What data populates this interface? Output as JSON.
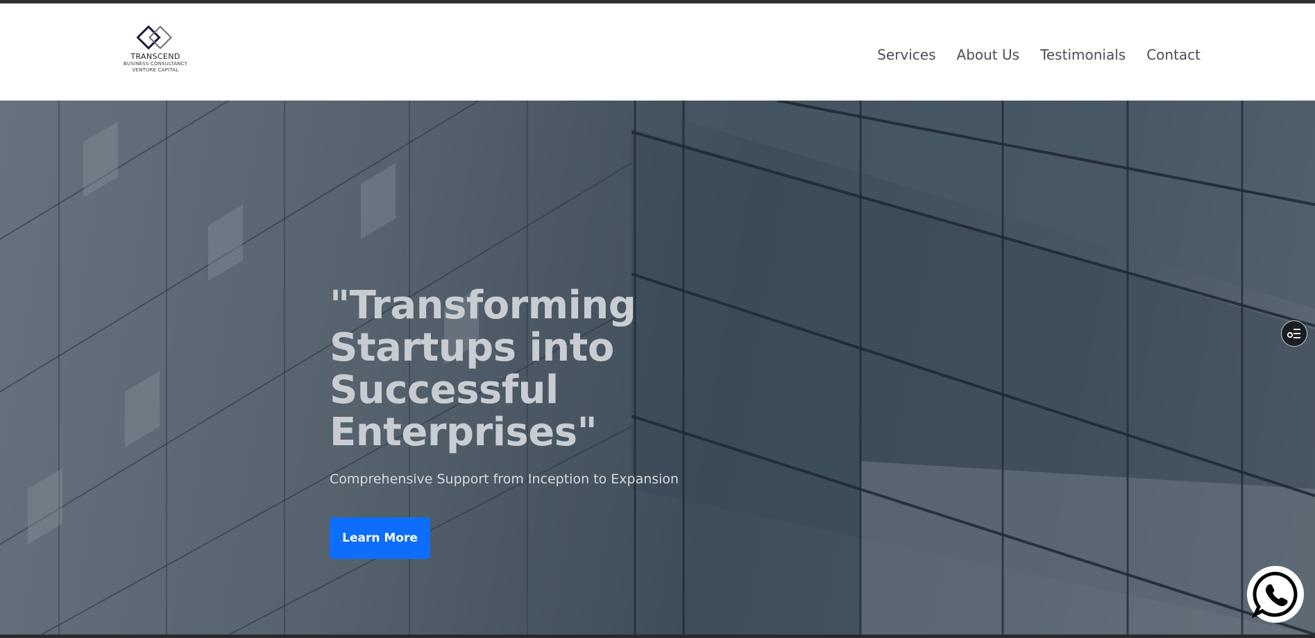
{
  "brand": {
    "name": "TRANSCEND",
    "tagline_1": "BUSINESS CONSULTANCY",
    "tagline_2": "VENTURE CAPITAL",
    "logo_icon": "double-diamond-logo"
  },
  "nav": {
    "items": [
      {
        "label": "Services"
      },
      {
        "label": "About Us"
      },
      {
        "label": "Testimonials"
      },
      {
        "label": "Contact"
      }
    ]
  },
  "hero": {
    "headline_lines": [
      "\"Transforming",
      "Startups into",
      "Successful",
      "Enterprises\""
    ],
    "subheadline": "Comprehensive Support from Inception to Expansion",
    "cta_label": "Learn More",
    "background": "glass-building-facade"
  },
  "widgets": {
    "side_widget_icon": "settings-list-icon",
    "chat_icon": "whatsapp-icon"
  },
  "colors": {
    "accent": "#0d6efd",
    "nav_text": "#4a4f58",
    "headline": "#c9cdd2",
    "header_bg": "#ffffff"
  }
}
